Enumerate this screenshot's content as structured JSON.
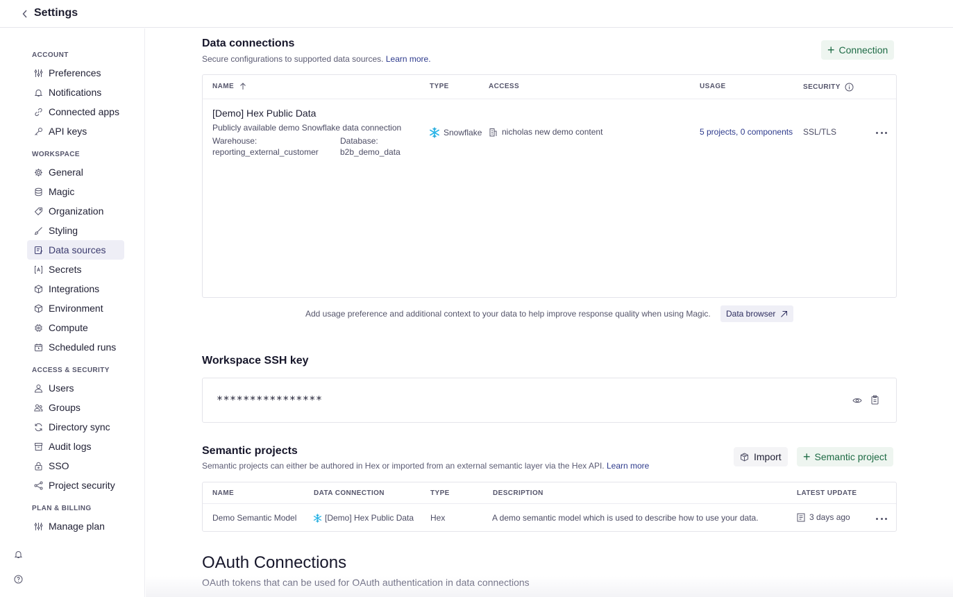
{
  "header": {
    "title": "Settings"
  },
  "sidebar": {
    "sections": [
      {
        "label": "ACCOUNT"
      },
      {
        "label": "WORKSPACE"
      },
      {
        "label": "ACCESS & SECURITY"
      },
      {
        "label": "PLAN & BILLING"
      }
    ],
    "items": [
      {
        "label": "Preferences",
        "icon": "sliders-icon"
      },
      {
        "label": "Notifications",
        "icon": "bell-icon"
      },
      {
        "label": "Connected apps",
        "icon": "link-icon"
      },
      {
        "label": "API keys",
        "icon": "key-icon"
      },
      {
        "label": "General",
        "icon": "gear-icon"
      },
      {
        "label": "Magic",
        "icon": "magic-icon"
      },
      {
        "label": "Organization",
        "icon": "tag-icon"
      },
      {
        "label": "Styling",
        "icon": "brush-icon"
      },
      {
        "label": "Data sources",
        "icon": "database-icon",
        "active": true
      },
      {
        "label": "Secrets",
        "icon": "secret-icon"
      },
      {
        "label": "Integrations",
        "icon": "cube-icon"
      },
      {
        "label": "Environment",
        "icon": "cube-icon"
      },
      {
        "label": "Compute",
        "icon": "chip-icon"
      },
      {
        "label": "Scheduled runs",
        "icon": "calendar-icon"
      },
      {
        "label": "Users",
        "icon": "user-icon"
      },
      {
        "label": "Groups",
        "icon": "users-icon"
      },
      {
        "label": "Directory sync",
        "icon": "sync-icon"
      },
      {
        "label": "Audit logs",
        "icon": "archive-icon"
      },
      {
        "label": "SSO",
        "icon": "lock-icon"
      },
      {
        "label": "Project security",
        "icon": "share-icon"
      },
      {
        "label": "Manage plan",
        "icon": "sliders-icon"
      }
    ]
  },
  "data_connections": {
    "title": "Data connections",
    "subtitle": "Secure configurations to supported data sources.",
    "learn_more": "Learn more.",
    "add_button": "Connection",
    "columns": {
      "name": "NAME",
      "type": "TYPE",
      "access": "ACCESS",
      "usage": "USAGE",
      "security": "SECURITY"
    },
    "rows": [
      {
        "name": "[Demo] Hex Public Data",
        "description": "Publicly available demo Snowflake data connection",
        "warehouse_label": "Warehouse:",
        "warehouse_value": "reporting_external_customer",
        "database_label": "Database:",
        "database_value": "b2b_demo_data",
        "type": "Snowflake",
        "access": "nicholas new demo content",
        "usage": "5 projects, 0 components",
        "security": "SSL/TLS"
      }
    ],
    "magic_note": "Add usage preference and additional context to your data to help improve response quality when using Magic.",
    "data_browser_button": "Data browser"
  },
  "ssh": {
    "title": "Workspace SSH key",
    "value": "****************"
  },
  "semantic": {
    "title": "Semantic projects",
    "subtitle": "Semantic projects can either be authored in Hex or imported from an external semantic layer via the Hex API.",
    "learn_more": "Learn more",
    "import_button": "Import",
    "add_button": "Semantic project",
    "columns": {
      "name": "NAME",
      "data_connection": "DATA CONNECTION",
      "type": "TYPE",
      "description": "DESCRIPTION",
      "latest_update": "LATEST UPDATE"
    },
    "rows": [
      {
        "name": "Demo Semantic Model",
        "data_connection": "[Demo] Hex Public Data",
        "type": "Hex",
        "description": "A demo semantic model which is used to describe how to use your data.",
        "latest_update": "3 days ago"
      }
    ]
  },
  "oauth": {
    "title": "OAuth Connections",
    "subtitle": "OAuth tokens that can be used for OAuth authentication in data connections"
  },
  "colors": {
    "accent_green": "#1e6b45",
    "link_blue": "#2d3a8c",
    "snowflake": "#29b5e8"
  }
}
